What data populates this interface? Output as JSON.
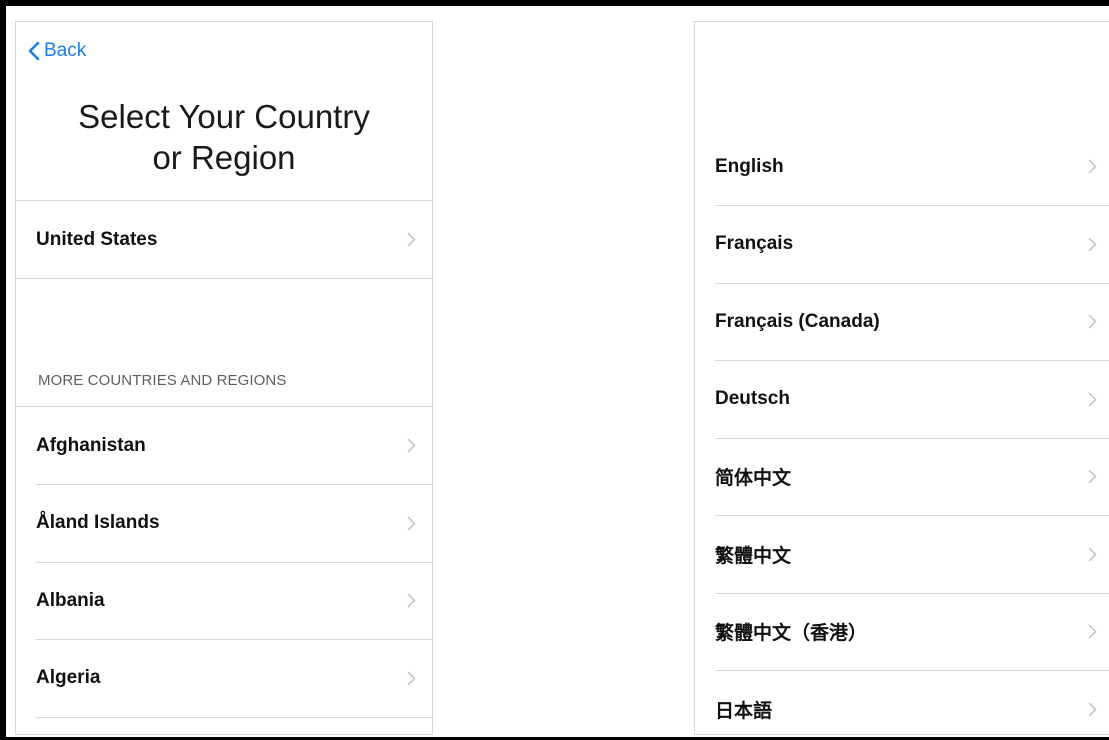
{
  "left_screen": {
    "back_label": "Back",
    "title_line1": "Select Your Country",
    "title_line2": "or Region",
    "top_item": "United States",
    "section_header": "MORE COUNTRIES AND REGIONS",
    "countries": [
      "Afghanistan",
      "Åland Islands",
      "Albania",
      "Algeria"
    ]
  },
  "right_screen": {
    "languages": [
      "English",
      "Français",
      "Français (Canada)",
      "Deutsch",
      "简体中文",
      "繁體中文",
      "繁體中文（香港）",
      "日本語"
    ]
  },
  "colors": {
    "accent": "#1a7cf5",
    "separator": "#d9d9d9",
    "chevron": "#c7c7cc"
  },
  "icons": {
    "back": "chevron-left-icon",
    "row": "chevron-right-icon"
  }
}
